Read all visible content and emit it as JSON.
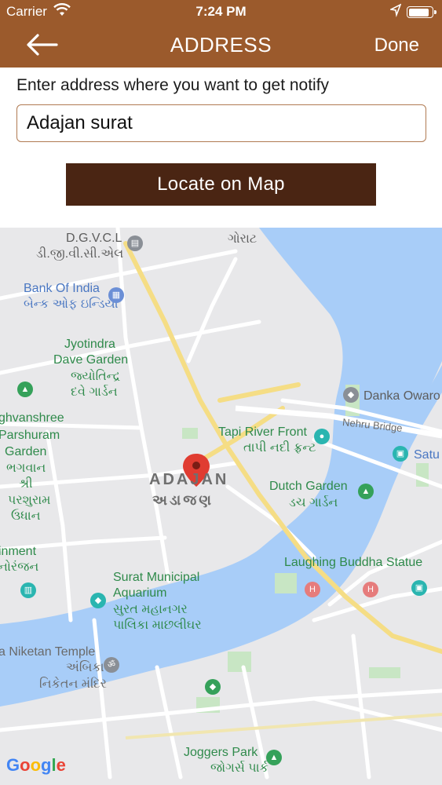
{
  "status_bar": {
    "carrier": "Carrier",
    "time": "7:24 PM",
    "battery_level": 0.9
  },
  "navbar": {
    "title": "ADDRESS",
    "done_label": "Done"
  },
  "form": {
    "prompt": "Enter address where you want to get notify",
    "address_value": "Adajan surat",
    "locate_label": "Locate on  Map"
  },
  "map": {
    "area_label": "ADAJAN",
    "area_label_local": "અડાજણ",
    "labels": {
      "dgvcl": "D.G.V.C.L",
      "dgvcl_local": "ડી.જી.વી.સી.એલ",
      "gorat_local": "ગોરાટ",
      "bank": "Bank Of India",
      "bank_local": "બેન્ક ઓફ ઇન્ડિયા",
      "jyotindra1": "Jyotindra",
      "jyotindra2": "Dave Garden",
      "jyotindra_local1": "જ્યોતિન્દ્ર",
      "jyotindra_local2": "દવે ગાર્ડન",
      "danka": "Danka Owaro",
      "nehru": "Nehru Bridge",
      "raghu1": "ghvanshree",
      "raghu2": "Parshuram",
      "raghu3": "Garden",
      "raghu_local1": "ભગવાન",
      "raghu_local2": "શ્રી",
      "raghu_local3": "પરશુરામ",
      "raghu_local4": "ઉધાન",
      "tapi": "Tapi River Front",
      "tapi_local": "તાપી નદી ફ્રન્ટ",
      "satu": "Satu",
      "dutch": "Dutch Garden",
      "dutch_local": "ડચ ગાર્ડન",
      "inment": "inment",
      "inment_local": "નોરંજન",
      "laughing": "Laughing Buddha Statue",
      "aquarium1": "Surat Municipal",
      "aquarium2": "Aquarium",
      "aquarium_local1": "સુરત મહાનગર",
      "aquarium_local2": "પાલિકા માછલીઘર",
      "niketan": "a Niketan Temple",
      "niketan_local1": "અંબિકા",
      "niketan_local2": "નિકેતન મંદિર",
      "joggers": "Joggers Park",
      "joggers_local": "જોગર્સ પાર્ક"
    },
    "attribution": "Google"
  },
  "colors": {
    "header": "#9b5a2c",
    "button": "#4a2513",
    "input_border": "#b07a52",
    "water": "#a8cdf8",
    "marker": "#e03c31"
  }
}
